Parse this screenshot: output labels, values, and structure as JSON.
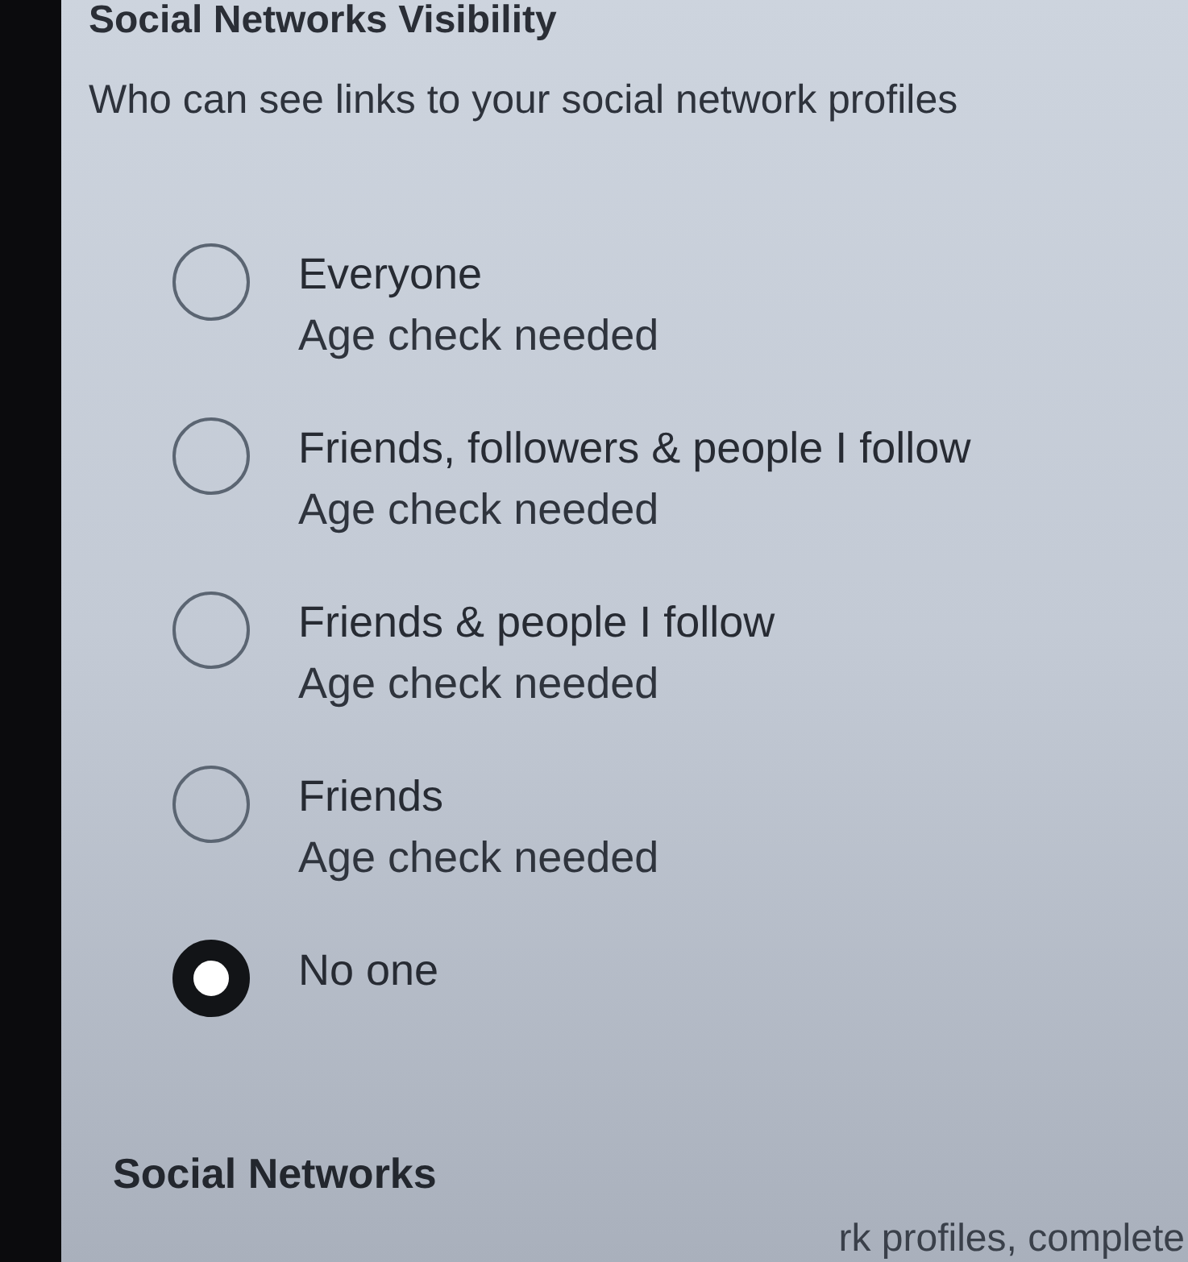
{
  "section": {
    "title": "Social Networks Visibility",
    "description": "Who can see links to your social network profiles"
  },
  "options": [
    {
      "label": "Everyone",
      "note": "Age check needed",
      "selected": false
    },
    {
      "label": "Friends, followers & people I follow",
      "note": "Age check needed",
      "selected": false
    },
    {
      "label": "Friends & people I follow",
      "note": "Age check needed",
      "selected": false
    },
    {
      "label": "Friends",
      "note": "Age check needed",
      "selected": false
    },
    {
      "label": "No one",
      "selected": true
    }
  ],
  "next_section": {
    "title": "Social Networks",
    "text": "rk profiles, complete"
  }
}
